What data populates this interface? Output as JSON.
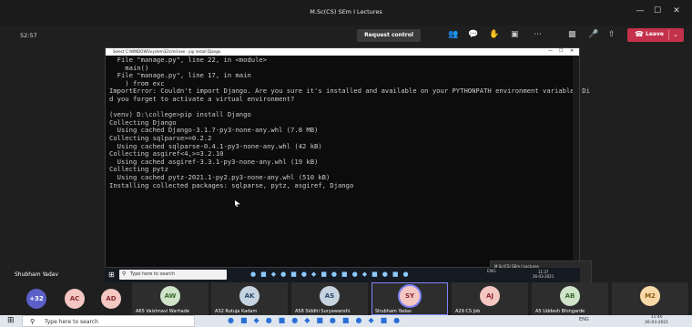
{
  "window": {
    "title": "M.Sc(CS) SEm I Lectures",
    "minimize": "—",
    "maximize": "☐",
    "close": "✕"
  },
  "toolbar": {
    "timer": "52:57",
    "request_control": "Request control",
    "leave": "Leave",
    "icons": [
      "people-icon",
      "chat-icon",
      "reactions-icon",
      "rooms-icon",
      "more-icon",
      "camera-off-icon",
      "mic-off-icon",
      "share-icon"
    ]
  },
  "cmd": {
    "title": "Select C:\\WINDOWS\\system32\\cmd.exe - pip  install Django",
    "lines": [
      "  File \"manage.py\", line 22, in <module>",
      "    main()",
      "  File \"manage.py\", line 17, in main",
      "    ) from exc",
      "ImportError: Couldn't import Django. Are you sure it's installed and available on your PYTHONPATH environment variable? Di",
      "d you forget to activate a virtual environment?",
      "",
      "(venv) D:\\college>pip install Django",
      "Collecting Django",
      "  Using cached Django-3.1.7-py3-none-any.whl (7.8 MB)",
      "Collecting sqlparse>=0.2.2",
      "  Using cached sqlparse-0.4.1-py3-none-any.whl (42 kB)",
      "Collecting asgiref<4,>=3.2.10",
      "  Using cached asgiref-3.3.1-py3-none-any.whl (19 kB)",
      "Collecting pytz",
      "  Using cached pytz-2021.1-py2.py3-none-any.whl (510 kB)",
      "Installing collected packages: sqlparse, pytz, asgiref, Django"
    ]
  },
  "mini_window": {
    "title": "M.Sc(CS) SEm I Lectures",
    "avatar": "AS"
  },
  "inner_taskbar": {
    "search_placeholder": "Type here to search",
    "tray": "ENG",
    "time": "11:37",
    "date": "26-03-2021"
  },
  "presenter": "Shubham Yadav",
  "participants": [
    {
      "initials": "+32",
      "name": "",
      "bg": "#5b5fc7",
      "fg": "#ffffff"
    },
    {
      "initials": "AC",
      "name": "",
      "bg": "#f4c7c3",
      "fg": "#8a2b2b"
    },
    {
      "initials": "AD",
      "name": "",
      "bg": "#f4c7c3",
      "fg": "#8a2b2b"
    },
    {
      "initials": "AW",
      "name": "A65 Vaishnavi Warhade",
      "bg": "#cfe3c8",
      "fg": "#3b6b2f"
    },
    {
      "initials": "AK",
      "name": "A32 Rutuja Kadam",
      "bg": "#c6d4df",
      "fg": "#24476b"
    },
    {
      "initials": "AS",
      "name": "A58 Siddhi Suryawanshi",
      "bg": "#c6d4df",
      "fg": "#24476b"
    },
    {
      "initials": "SY",
      "name": "Shubham Yadav",
      "bg": "#f4c7c3",
      "fg": "#8a2b2b"
    },
    {
      "initials": "AJ",
      "name": "A29 CS Job",
      "bg": "#f4c7c3",
      "fg": "#8a2b2b"
    },
    {
      "initials": "AB",
      "name": "A5 Uddesh Bhingarde",
      "bg": "#cfe3c8",
      "fg": "#3b6b2f"
    },
    {
      "initials": "M2",
      "name": "",
      "bg": "#f7d9a8",
      "fg": "#8a5a14"
    }
  ],
  "host_taskbar": {
    "search_placeholder": "Type here to search",
    "tray": "ENG",
    "time": "11:40",
    "date": "26-03-2021"
  }
}
